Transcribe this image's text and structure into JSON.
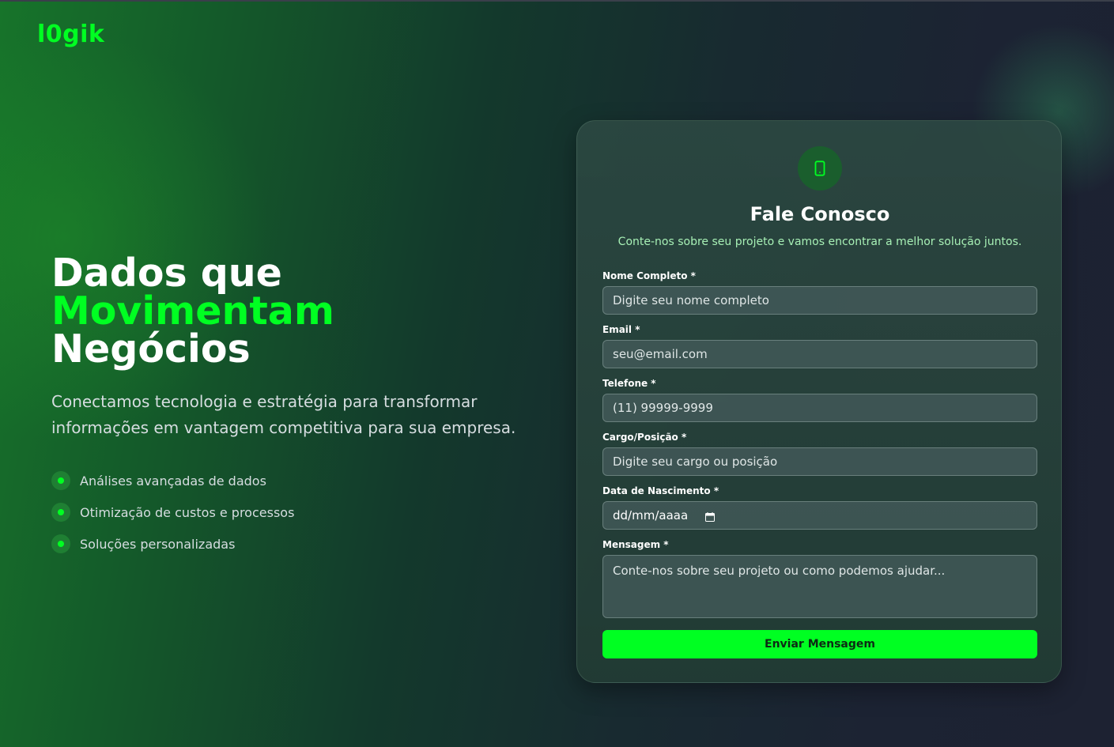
{
  "brand": {
    "logo": "l0gik",
    "accent_color": "#00ff22"
  },
  "hero": {
    "title_line1": "Dados que",
    "title_line2": "Movimentam",
    "title_line3": "Negócios",
    "description": "Conectamos tecnologia e estratégia para transformar informações em vantagem competitiva para sua empresa.",
    "features": [
      {
        "icon": "green-dot-icon",
        "label": "Análises avançadas de dados"
      },
      {
        "icon": "green-dot-icon",
        "label": "Otimização de custos e processos"
      },
      {
        "icon": "green-dot-icon",
        "label": "Soluções personalizadas"
      }
    ]
  },
  "contact_form": {
    "icon": "smartphone-icon",
    "title": "Fale Conosco",
    "subtitle": "Conte-nos sobre seu projeto e vamos encontrar a melhor solução juntos.",
    "fields": {
      "name": {
        "label": "Nome Completo *",
        "placeholder": "Digite seu nome completo",
        "value": ""
      },
      "email": {
        "label": "Email *",
        "placeholder": "seu@email.com",
        "value": ""
      },
      "phone": {
        "label": "Telefone *",
        "placeholder": "(11) 99999-9999",
        "value": ""
      },
      "role": {
        "label": "Cargo/Posição *",
        "placeholder": "Digite seu cargo ou posição",
        "value": ""
      },
      "birthdate": {
        "label": "Data de Nascimento *",
        "value": "dd/mm/aaaa",
        "icon": "calendar-icon"
      },
      "message": {
        "label": "Mensagem *",
        "placeholder": "Conte-nos sobre seu projeto ou como podemos ajudar...",
        "value": ""
      }
    },
    "submit_label": "Enviar Mensagem"
  }
}
